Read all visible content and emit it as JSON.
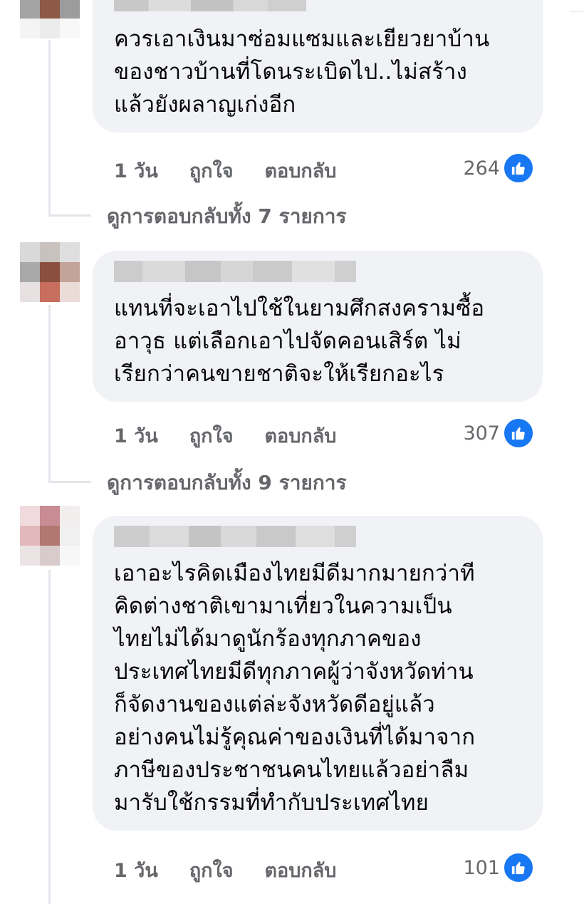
{
  "comments": [
    {
      "text": "ควรเอาเงินมาซ่อมแซมและเยียวยาบ้าน\nของชาวบ้านที่โดนระเบิดไป..ไม่สร้าง\nแล้วยังผลาญเก่งอีก",
      "time": "1 วัน",
      "like_label": "ถูกใจ",
      "reply_label": "ตอบกลับ",
      "reaction_count": "264",
      "view_replies": "ดูการตอบกลับทั้ง 7 รายการ"
    },
    {
      "text": "แทนที่จะเอาไปใช้ในยามศึกสงครามซื้อ\nอาวุธ แต่เลือกเอาไปจัดคอนเสิร์ต ไม่\nเรียกว่าคนขายชาติจะให้เรียกอะไร",
      "time": "1 วัน",
      "like_label": "ถูกใจ",
      "reply_label": "ตอบกลับ",
      "reaction_count": "307",
      "view_replies": "ดูการตอบกลับทั้ง 9 รายการ"
    },
    {
      "text": "เอาอะไรคิดเมืองไทยมีดีมากมายกว่าที\nคิดต่างชาติเขามาเที่ยวในความเป็น\nไทยไม่ได้มาดูนักร้องทุกภาคของ\nประเทศไทยมีดีทุกภาคผู้ว่าจังหวัดท่าน\nก็จัดงานของแต่ล่ะจังหวัดดีอยู่แล้ว\nอย่างคนไม่รู้คุณค่าของเงินที่ได้มาจาก\nภาษีของประชาชนคนไทยแล้วอย่าลืม\nมารับใช้กรรมที่ทำกับประเทศไทย",
      "time": "1 วัน",
      "like_label": "ถูกใจ",
      "reply_label": "ตอบกลับ",
      "reaction_count": "101"
    }
  ],
  "icons": {
    "reaction": "like-thumb-icon"
  },
  "colors": {
    "bubble": "#f0f2f5",
    "meta": "#65676b",
    "like": "#1877f2"
  }
}
